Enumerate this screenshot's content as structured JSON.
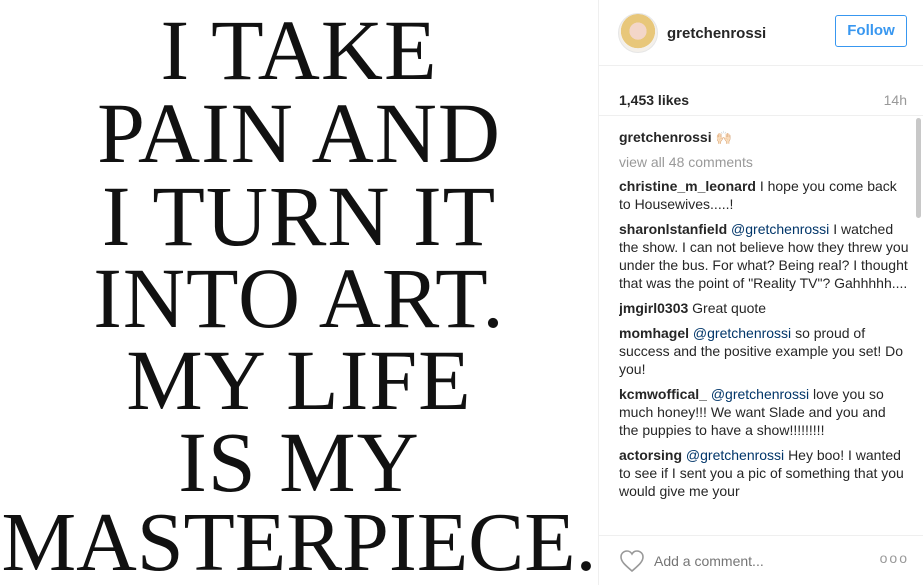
{
  "post": {
    "image_text": [
      "I TAKE",
      "PAIN AND",
      "I TURN IT",
      "INTO ART.",
      "MY LIFE",
      "IS MY",
      "MASTERPIECE."
    ]
  },
  "header": {
    "username": "gretchenrossi",
    "follow_label": "Follow"
  },
  "stats": {
    "likes": "1,453 likes",
    "time": "14h"
  },
  "caption": {
    "username": "gretchenrossi",
    "emoji": "🙌🏻"
  },
  "view_all": "view all 48 comments",
  "comments": [
    {
      "username": "christine_m_leonard",
      "mention": "",
      "text": "I hope you come back to Housewives.....!"
    },
    {
      "username": "sharonlstanfield",
      "mention": "@gretchenrossi",
      "text": "I watched the show. I can not believe how they threw you under the bus. For what? Being real? I thought that was the point of \"Reality TV\"? Gahhhhh...."
    },
    {
      "username": "jmgirl0303",
      "mention": "",
      "text": "Great quote"
    },
    {
      "username": "momhagel",
      "mention": "@gretchenrossi",
      "text": "so proud of success and the positive example you set! Do you!"
    },
    {
      "username": "kcmwoffical_",
      "mention": "@gretchenrossi",
      "text": "love you so much honey!!! We want Slade and you and the puppies to have a show!!!!!!!!!"
    },
    {
      "username": "actorsing",
      "mention": "@gretchenrossi",
      "text": "Hey boo! I wanted to see if I sent you a pic of something that you would give me your"
    }
  ],
  "footer": {
    "add_comment_placeholder": "Add a comment...",
    "more_label": "ooo"
  },
  "colors": {
    "accent": "#3897f0",
    "mention": "#003569",
    "muted": "#999999"
  }
}
